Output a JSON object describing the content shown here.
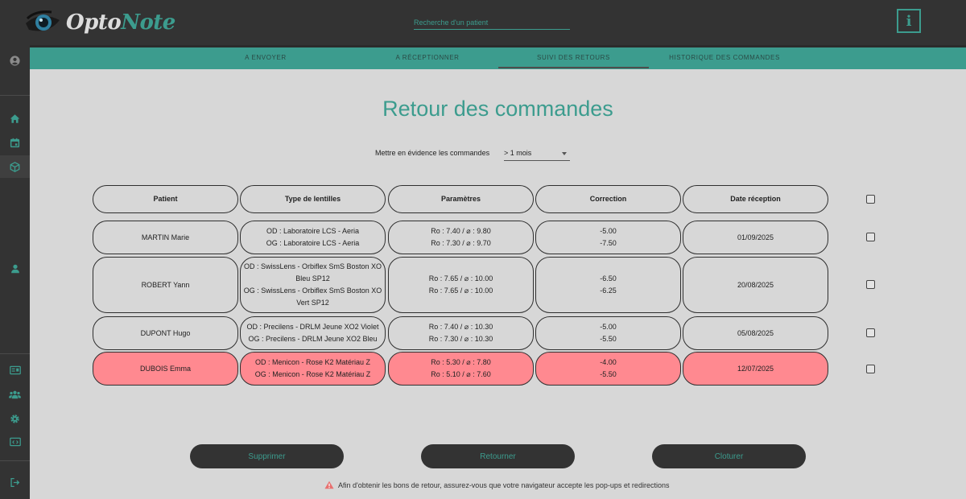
{
  "app": {
    "logo_part1": "Opto",
    "logo_part2": "Note",
    "search_placeholder": "Recherche d'un patient",
    "info_label": "i"
  },
  "tabs": [
    {
      "label": "A ENVOYER"
    },
    {
      "label": "A RÉCEPTIONNER"
    },
    {
      "label": "SUIVI DES RETOURS",
      "active": true
    },
    {
      "label": "HISTORIQUE DES COMMANDES"
    }
  ],
  "sidebar": {
    "icons": [
      "user-circle-icon",
      "home-icon",
      "calendar-icon",
      "box-icon",
      "person-icon",
      "id-card-icon",
      "group-icon",
      "gear-icon",
      "code-window-icon",
      "logout-icon"
    ],
    "active": "box-icon"
  },
  "page": {
    "title": "Retour des commandes",
    "filter_label": "Mettre en évidence les commandes",
    "filter_value": "> 1 mois"
  },
  "table": {
    "headers": [
      "Patient",
      "Type de lentilles",
      "Paramètres",
      "Correction",
      "Date réception"
    ],
    "rows": [
      {
        "patient": "MARTIN Marie",
        "lens": [
          "OD : Laboratoire LCS - Aeria",
          "OG : Laboratoire LCS - Aeria"
        ],
        "params": [
          "Ro : 7.40 / ⌀ : 9.80",
          "Ro : 7.30 / ⌀ : 9.70"
        ],
        "correction": [
          "-5.00",
          "-7.50"
        ],
        "date": "01/09/2025",
        "highlight": false
      },
      {
        "patient": "ROBERT Yann",
        "lens": [
          "OD : SwissLens - Orbiflex SmS Boston XO",
          "Bleu SP12",
          "OG : SwissLens - Orbiflex SmS Boston XO",
          "Vert SP12"
        ],
        "params": [
          "Ro : 7.65 / ⌀ : 10.00",
          "Ro : 7.65 / ⌀ : 10.00"
        ],
        "correction": [
          "-6.50",
          "-6.25"
        ],
        "date": "20/08/2025",
        "highlight": false
      },
      {
        "patient": "DUPONT Hugo",
        "lens": [
          "OD : Precilens - DRLM Jeune XO2 Violet",
          "OG : Precilens - DRLM Jeune XO2 Bleu"
        ],
        "params": [
          "Ro : 7.40 / ⌀ : 10.30",
          "Ro : 7.30 / ⌀ : 10.30"
        ],
        "correction": [
          "-5.00",
          "-5.50"
        ],
        "date": "05/08/2025",
        "highlight": false
      },
      {
        "patient": "DUBOIS Emma",
        "lens": [
          "OD : Menicon - Rose K2 Matériau Z",
          "OG : Menicon - Rose K2 Matériau Z"
        ],
        "params": [
          "Ro : 5.30 / ⌀ : 7.80",
          "Ro : 5.10 / ⌀ : 7.60"
        ],
        "correction": [
          "-4.00",
          "-5.50"
        ],
        "date": "12/07/2025",
        "highlight": true
      }
    ]
  },
  "actions": {
    "delete": "Supprimer",
    "return": "Retourner",
    "close": "Cloturer"
  },
  "notice": "Afin d'obtenir les bons de retour, assurez-vous que votre navigateur accepte les pop-ups et redirections",
  "colors": {
    "accent": "#3c9c8e",
    "dark": "#333333",
    "background": "#d7d7d7",
    "highlight_row": "#ff8990"
  }
}
